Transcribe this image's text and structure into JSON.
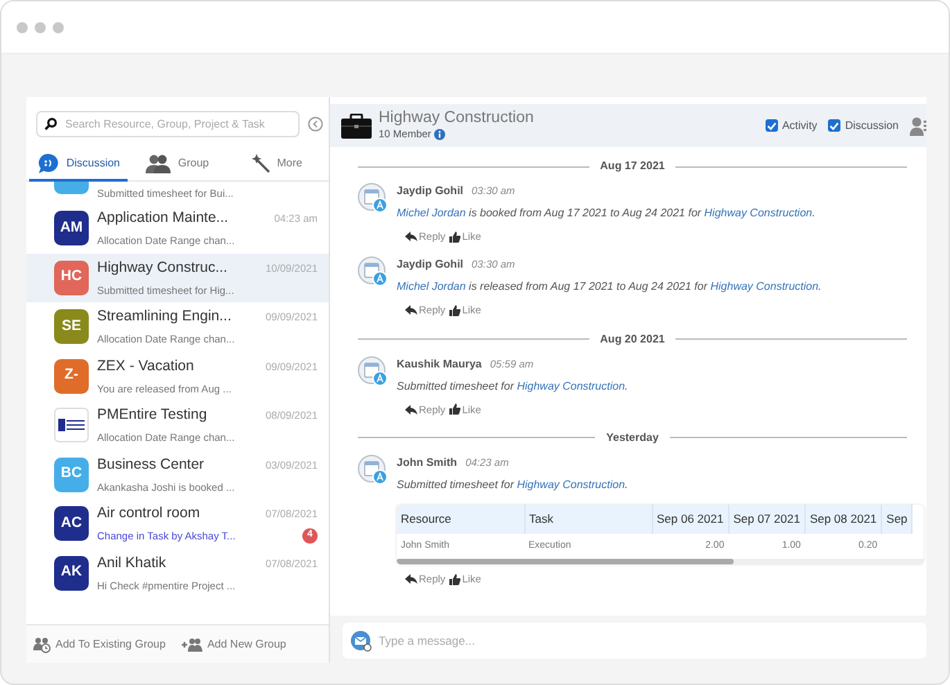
{
  "sidebar": {
    "search": {
      "placeholder": "Search Resource, Group, Project & Task"
    },
    "tabs": [
      {
        "label": "Discussion",
        "selected": true
      },
      {
        "label": "Group",
        "selected": false
      },
      {
        "label": "More",
        "selected": false
      }
    ],
    "conversations": [
      {
        "kind": "cut",
        "color": "#45aee8",
        "preview": "Submitted timesheet for Bui...",
        "selected": false,
        "unread": false
      },
      {
        "kind": "initials",
        "avatar": "AM",
        "color": "#1f2d8c",
        "title": "Application Mainte...",
        "time": "04:23 am",
        "preview": "Allocation Date Range chan...",
        "selected": false,
        "unread": false
      },
      {
        "kind": "initials",
        "avatar": "HC",
        "color": "#e0675a",
        "title": "Highway Construc...",
        "time": "10/09/2021",
        "preview": "Submitted timesheet for Hig...",
        "selected": true,
        "unread": false
      },
      {
        "kind": "initials",
        "avatar": "SE",
        "color": "#8a8a1c",
        "title": "Streamlining Engin...",
        "time": "09/09/2021",
        "preview": "Allocation Date Range chan...",
        "selected": false,
        "unread": false
      },
      {
        "kind": "initials",
        "avatar": "Z-",
        "color": "#e06c2a",
        "title": "ZEX - Vacation",
        "time": "09/09/2021",
        "preview": "You are released from Aug ...",
        "selected": false,
        "unread": false
      },
      {
        "kind": "logo",
        "title": "PMEntire Testing",
        "time": "08/09/2021",
        "preview": "Allocation Date Range chan...",
        "selected": false,
        "unread": false
      },
      {
        "kind": "initials",
        "avatar": "BC",
        "color": "#45aee8",
        "title": "Business Center",
        "time": "03/09/2021",
        "preview": "Akankasha Joshi is booked ...",
        "selected": false,
        "unread": false
      },
      {
        "kind": "initials",
        "avatar": "AC",
        "color": "#1f2d8c",
        "title": "Air control room",
        "time": "07/08/2021",
        "preview": "Change in Task by Akshay T...",
        "selected": false,
        "unread": true,
        "badge": "4"
      },
      {
        "kind": "initials",
        "avatar": "AK",
        "color": "#1f2d8c",
        "title": "Anil Khatik",
        "time": "07/08/2021",
        "preview": "Hi Check #pmentire Project ...",
        "selected": false,
        "unread": false
      }
    ],
    "footer_actions": [
      {
        "label": "Add To Existing Group"
      },
      {
        "label": "Add New Group"
      }
    ]
  },
  "chat": {
    "title": "Highway Construction",
    "members": "10 Member",
    "filters": [
      {
        "label": "Activity",
        "checked": true
      },
      {
        "label": "Discussion",
        "checked": true
      }
    ],
    "feed": [
      {
        "kind": "date",
        "label": "Aug 17 2021"
      },
      {
        "kind": "message",
        "author": "Jaydip Gohil",
        "time": "03:30 am",
        "text": [
          {
            "text": "Michel Jordan",
            "link": true
          },
          {
            "text": " is booked from Aug 17 2021 to Aug 24 2021 for ",
            "link": false
          },
          {
            "text": "Highway Construction",
            "link": true
          },
          {
            "text": ".",
            "link": false
          }
        ],
        "actions": [
          "Reply",
          "Like"
        ]
      },
      {
        "kind": "message",
        "author": "Jaydip Gohil",
        "time": "03:30 am",
        "text": [
          {
            "text": "Michel Jordan",
            "link": true
          },
          {
            "text": " is released from Aug 17 2021 to Aug 24 2021 for ",
            "link": false
          },
          {
            "text": "Highway Construction",
            "link": true
          },
          {
            "text": ".",
            "link": false
          }
        ],
        "actions": [
          "Reply",
          "Like"
        ]
      },
      {
        "kind": "date",
        "label": "Aug 20 2021"
      },
      {
        "kind": "message",
        "author": "Kaushik Maurya",
        "time": "05:59 am",
        "text": [
          {
            "text": "Submitted timesheet for ",
            "link": false
          },
          {
            "text": "Highway Construction",
            "link": true
          },
          {
            "text": ".",
            "link": false
          }
        ],
        "actions": [
          "Reply",
          "Like"
        ]
      },
      {
        "kind": "date",
        "label": "Yesterday"
      },
      {
        "kind": "message",
        "author": "John Smith",
        "time": "04:23 am",
        "text": [
          {
            "text": "Submitted timesheet for ",
            "link": false
          },
          {
            "text": "Highway Construction",
            "link": true
          },
          {
            "text": ".",
            "link": false
          }
        ],
        "table": {
          "columns": [
            "Resource",
            "Task",
            "Sep 06 2021",
            "Sep 07 2021",
            "Sep 08 2021",
            "Sep"
          ],
          "rows": [
            [
              "John Smith",
              "Execution",
              "2.00",
              "1.00",
              "0.20"
            ]
          ]
        },
        "actions": [
          "Reply",
          "Like"
        ]
      }
    ],
    "composer": {
      "placeholder": "Type a message..."
    }
  }
}
